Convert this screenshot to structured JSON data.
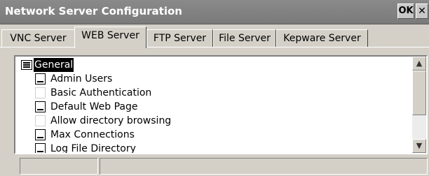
{
  "window": {
    "title": "Network Server Configuration",
    "ok_label": "OK",
    "close_label": "✕"
  },
  "tabs": [
    {
      "label": "VNC Server",
      "active": false
    },
    {
      "label": "WEB Server",
      "active": true
    },
    {
      "label": "FTP Server",
      "active": false
    },
    {
      "label": "File Server",
      "active": false
    },
    {
      "label": "Kepware Server",
      "active": false
    }
  ],
  "tree": {
    "root": {
      "label": "General",
      "icon": "list-folder-icon",
      "selected": true
    },
    "children": [
      {
        "label": "Admin Users",
        "icon": "property-icon"
      },
      {
        "label": "Basic Authentication",
        "icon": "blank-icon"
      },
      {
        "label": "Default Web Page",
        "icon": "property-icon"
      },
      {
        "label": "Allow directory browsing",
        "icon": "blank-icon"
      },
      {
        "label": "Max Connections",
        "icon": "property-icon"
      },
      {
        "label": "Log File Directory",
        "icon": "property-icon"
      }
    ]
  },
  "scrollbar": {
    "up_icon": "▲",
    "down_icon": "▼"
  },
  "statusbar": {
    "cells": [
      "",
      ""
    ]
  },
  "colors": {
    "titlebar": "#7d7d7d",
    "window_bg": "#d4d0c8",
    "selection": "#000000"
  }
}
